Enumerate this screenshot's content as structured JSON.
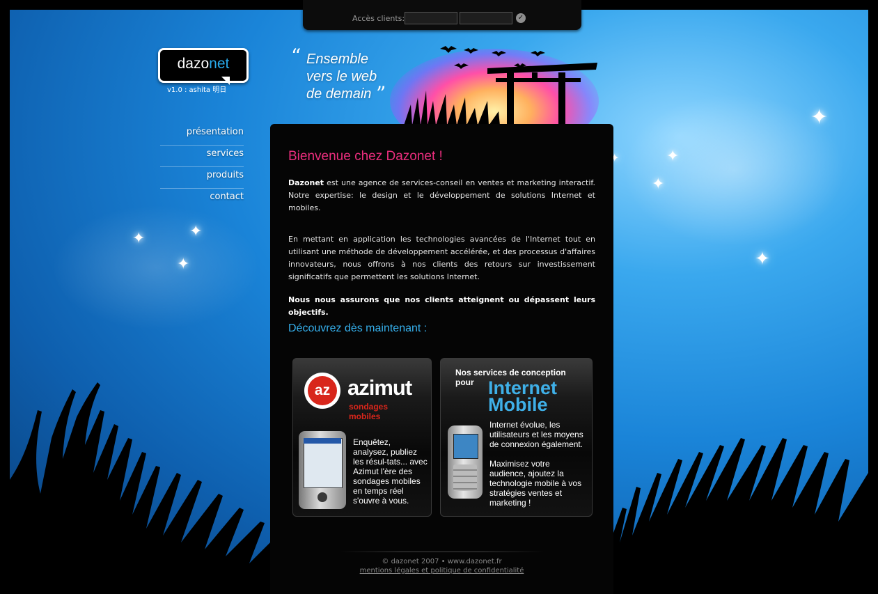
{
  "login": {
    "label": "Accès clients:",
    "user_value": "",
    "pass_value": "",
    "submit_icon": "check-icon"
  },
  "logo": {
    "part1": "dazo",
    "part2": "net",
    "version": "v1.0 : ashita 明日"
  },
  "nav": {
    "items": [
      {
        "label": "présentation"
      },
      {
        "label": "services"
      },
      {
        "label": "produits"
      },
      {
        "label": "contact"
      }
    ]
  },
  "tagline": {
    "open_quote": "“",
    "line1": "Ensemble",
    "line2": "vers le web",
    "line3": "de demain",
    "close_quote": "”"
  },
  "content": {
    "title": "Bienvenue chez Dazonet !",
    "p1_brand": "Dazonet",
    "p1_rest": " est une agence de services-conseil en ventes et marketing interactif. Notre expertise: le design et le développement de solutions Internet et mobiles.",
    "p2": "En mettant en application les technologies avancées de l'Internet tout en utilisant une méthode de développement accélérée, et des processus d'affaires innovateurs, nous offrons à nos clients des retours sur investissement significatifs que permettent les solutions Internet.",
    "p3": "Nous nous assurons que nos clients atteignent ou dépassent leurs objectifs.",
    "discover": "Découvrez dès maintenant :"
  },
  "promo_azimut": {
    "logo_letters": "az",
    "name": "azimut",
    "sub1": "sondages",
    "sub2": "mobiles",
    "text": "Enquêtez, analysez, publiez les résul-tats... avec Azimut l'ère des sondages mobiles en temps réel s'ouvre à vous."
  },
  "promo_mobile": {
    "head1": "Nos services de conception",
    "head2": "pour",
    "big1": "Internet",
    "big2": "Mobile",
    "text1": "Internet évolue, les utilisateurs et les moyens de connexion également.",
    "text2": "Maximisez votre audience, ajoutez la technologie mobile à vos stratégies ventes et marketing !"
  },
  "footer": {
    "copyright": "© dazonet 2007 • www.dazonet.fr",
    "legal_link": "mentions légales et politique de confidentialité"
  },
  "colors": {
    "accent_pink": "#ec2e7e",
    "accent_blue": "#36b1ee",
    "azimut_red": "#d8261b"
  }
}
